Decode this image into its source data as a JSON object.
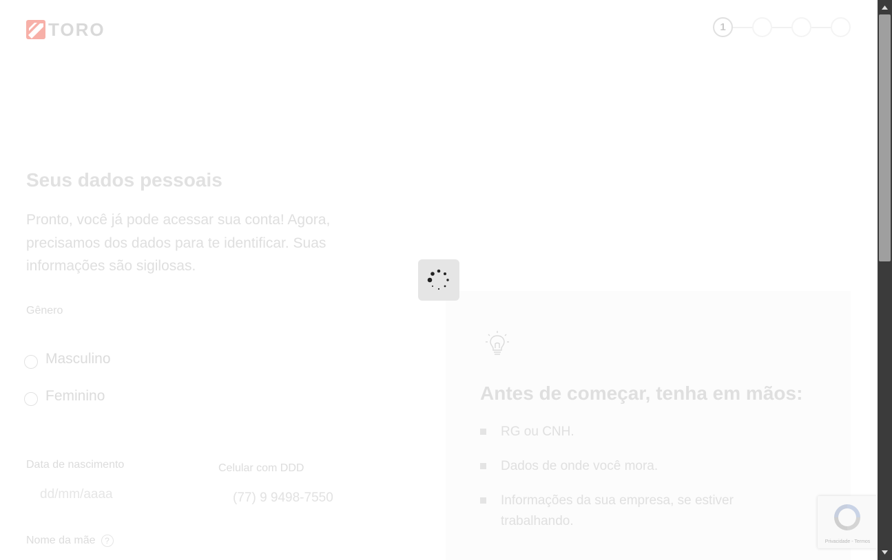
{
  "brand": {
    "name": "TORO",
    "accent": "#f15a4a"
  },
  "steps": [
    "1",
    "",
    "",
    ""
  ],
  "form": {
    "title": "Seus dados pessoais",
    "intro": "Pronto, você já pode acessar sua conta! Agora, precisamos dos dados para te identificar. Suas informações são sigilosas.",
    "gender_label": "Gênero",
    "gender_options": [
      "Masculino",
      "Feminino"
    ],
    "birthdate_label": "Data de nascimento",
    "birthdate_placeholder": "dd/mm/aaaa",
    "phone_label": "Celular com DDD",
    "phone_value": "(77) 9 9498-7550",
    "mother_label": "Nome da mãe",
    "help_icon": "?"
  },
  "checklist": {
    "icon": "lightbulb-icon",
    "title": "Antes de começar, tenha em mãos:",
    "items": [
      "RG ou CNH.",
      "Dados de onde você mora.",
      "Informações da sua empresa, se estiver trabalhando."
    ]
  },
  "loading": {
    "icon": "spinner-icon"
  },
  "recaptcha": {
    "icon": "recaptcha-icon",
    "terms": "Privacidade - Termos"
  },
  "scrollbar": {
    "up_icon": "arrow-up-icon",
    "down_icon": "arrow-down-icon"
  }
}
